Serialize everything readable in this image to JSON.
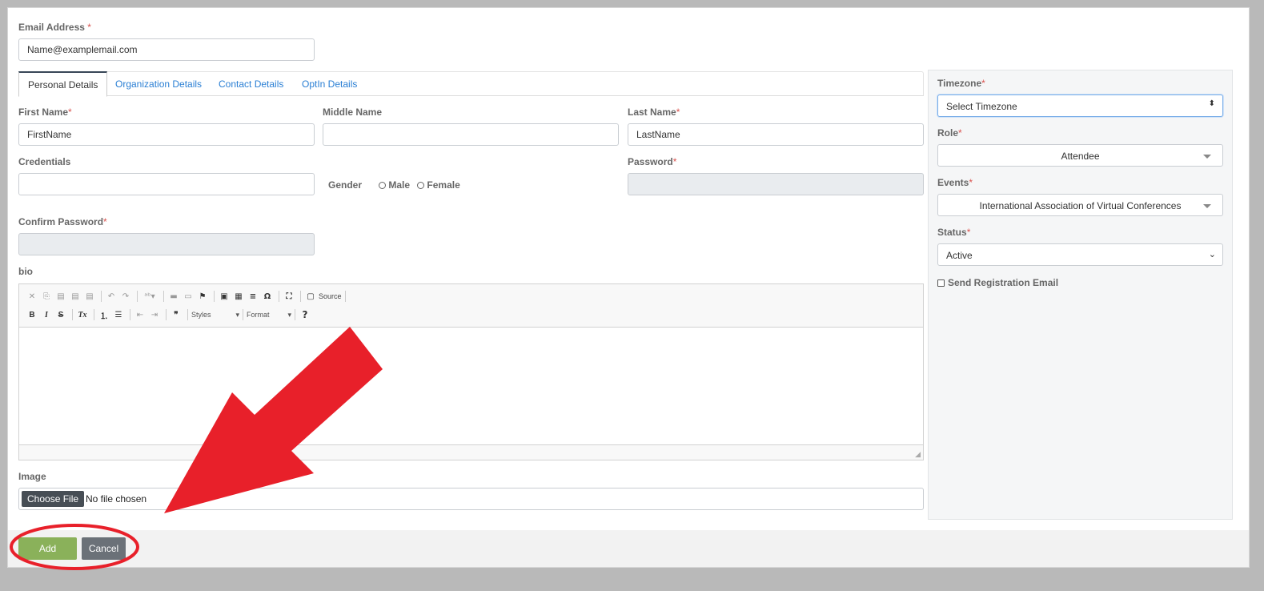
{
  "email": {
    "label": "Email Address",
    "required": "*",
    "value": "Name@examplemail.com"
  },
  "tabs": [
    {
      "label": "Personal Details"
    },
    {
      "label": "Organization Details"
    },
    {
      "label": "Contact Details"
    },
    {
      "label": "OptIn Details"
    }
  ],
  "personal": {
    "first_name": {
      "label": "First Name",
      "required": "*",
      "placeholder": "FirstName"
    },
    "middle_name": {
      "label": "Middle Name",
      "value": ""
    },
    "last_name": {
      "label": "Last Name",
      "required": "*",
      "placeholder": "LastName"
    },
    "credentials": {
      "label": "Credentials",
      "value": ""
    },
    "gender": {
      "label": "Gender",
      "options": [
        "Male",
        "Female"
      ]
    },
    "password": {
      "label": "Password",
      "required": "*"
    },
    "confirm_password": {
      "label": "Confirm Password",
      "required": "*"
    },
    "bio": {
      "label": "bio"
    }
  },
  "editor": {
    "source_label": "Source",
    "styles_label": "Styles",
    "format_label": "Format",
    "help_label": "?"
  },
  "image": {
    "label": "Image",
    "button": "Choose File",
    "status": "No file chosen"
  },
  "sidebar": {
    "timezone": {
      "label": "Timezone",
      "required": "*",
      "value": "Select Timezone"
    },
    "role": {
      "label": "Role",
      "required": "*",
      "value": "Attendee"
    },
    "events": {
      "label": "Events",
      "required": "*",
      "value": "International Association of Virtual Conferences"
    },
    "status": {
      "label": "Status",
      "required": "*",
      "value": "Active"
    },
    "send_email": {
      "label": "Send Registration Email"
    }
  },
  "actions": {
    "add": "Add",
    "cancel": "Cancel"
  },
  "colors": {
    "accent": "#2a7fd4",
    "add_button": "#8ab15a",
    "cancel_button": "#6b7178",
    "annotation": "#e8202a"
  }
}
